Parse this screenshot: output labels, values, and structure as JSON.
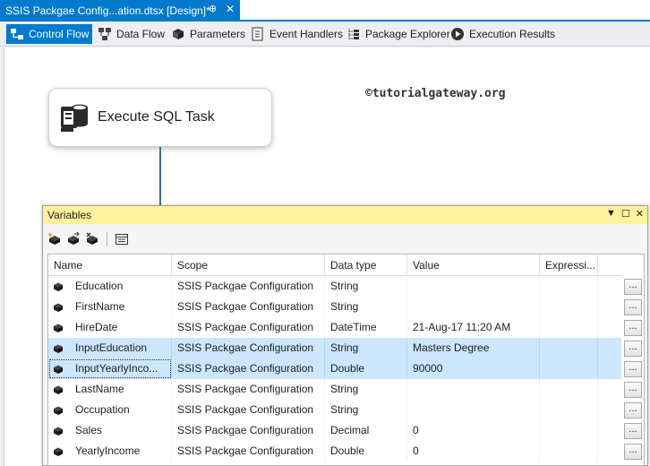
{
  "document_tab": {
    "title": "SSIS Packgae Config...ation.dtsx [Design]*",
    "pin": "⊕",
    "close": "✕"
  },
  "designer_tabs": [
    {
      "label": "Control Flow",
      "icon": "control-flow-icon"
    },
    {
      "label": "Data Flow",
      "icon": "data-flow-icon"
    },
    {
      "label": "Parameters",
      "icon": "parameters-icon"
    },
    {
      "label": "Event Handlers",
      "icon": "event-handlers-icon"
    },
    {
      "label": "Package Explorer",
      "icon": "package-explorer-icon"
    },
    {
      "label": "Execution Results",
      "icon": "execution-results-icon"
    }
  ],
  "canvas": {
    "watermark": "©tutorialgateway.org",
    "task": {
      "label": "Execute SQL Task",
      "icon": "execute-sql-task-icon"
    }
  },
  "variables_window": {
    "title": "Variables",
    "toolbar": [
      "add-variable-icon",
      "move-variable-icon",
      "delete-variable-icon",
      "grid-options-icon"
    ],
    "columns": [
      "Name",
      "Scope",
      "Data type",
      "Value",
      "Expressi..."
    ],
    "rows": [
      {
        "name": "Education",
        "scope": "SSIS Packgae Configuration",
        "type": "String",
        "value": "",
        "expr": "",
        "selected": false
      },
      {
        "name": "FirstName",
        "scope": "SSIS Packgae Configuration",
        "type": "String",
        "value": "",
        "expr": "",
        "selected": false
      },
      {
        "name": "HireDate",
        "scope": "SSIS Packgae Configuration",
        "type": "DateTime",
        "value": "21-Aug-17 11:20 AM",
        "expr": "",
        "selected": false
      },
      {
        "name": "InputEducation",
        "scope": "SSIS Packgae Configuration",
        "type": "String",
        "value": "Masters Degree",
        "expr": "",
        "selected": true
      },
      {
        "name": "InputYearlyInco...",
        "scope": "SSIS Packgae Configuration",
        "type": "Double",
        "value": "90000",
        "expr": "",
        "selected": true
      },
      {
        "name": "LastName",
        "scope": "SSIS Packgae Configuration",
        "type": "String",
        "value": "",
        "expr": "",
        "selected": false
      },
      {
        "name": "Occupation",
        "scope": "SSIS Packgae Configuration",
        "type": "String",
        "value": "",
        "expr": "",
        "selected": false
      },
      {
        "name": "Sales",
        "scope": "SSIS Packgae Configuration",
        "type": "Decimal",
        "value": "0",
        "expr": "",
        "selected": false
      },
      {
        "name": "YearlyIncome",
        "scope": "SSIS Packgae Configuration",
        "type": "Double",
        "value": "0",
        "expr": "",
        "selected": false
      }
    ],
    "ellipsis_label": "...",
    "header_buttons": [
      "▼",
      "☐",
      "✕"
    ]
  },
  "colors": {
    "accent": "#007acc",
    "window_header": "#fff29d",
    "selection": "#cce6ff"
  }
}
